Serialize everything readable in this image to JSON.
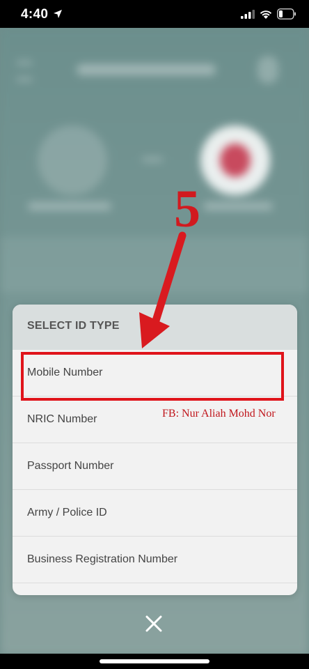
{
  "status_bar": {
    "time": "4:40",
    "icons": [
      "location-arrow-icon",
      "cellular-signal-icon",
      "wifi-icon",
      "battery-icon"
    ]
  },
  "sheet": {
    "title": "SELECT ID TYPE",
    "options": [
      {
        "label": "Mobile Number"
      },
      {
        "label": "NRIC Number"
      },
      {
        "label": "Passport Number"
      },
      {
        "label": "Army / Police ID"
      },
      {
        "label": "Business Registration Number"
      }
    ]
  },
  "annotation": {
    "step_number": "5",
    "watermark": "FB: Nur Aliah Mohd Nor",
    "highlight_color": "#e0141b"
  },
  "close": {
    "icon": "close-icon"
  },
  "colors": {
    "sheet_background": "#f2f2f2",
    "sheet_header": "#d9dede",
    "annotation_red": "#d11a1f"
  }
}
